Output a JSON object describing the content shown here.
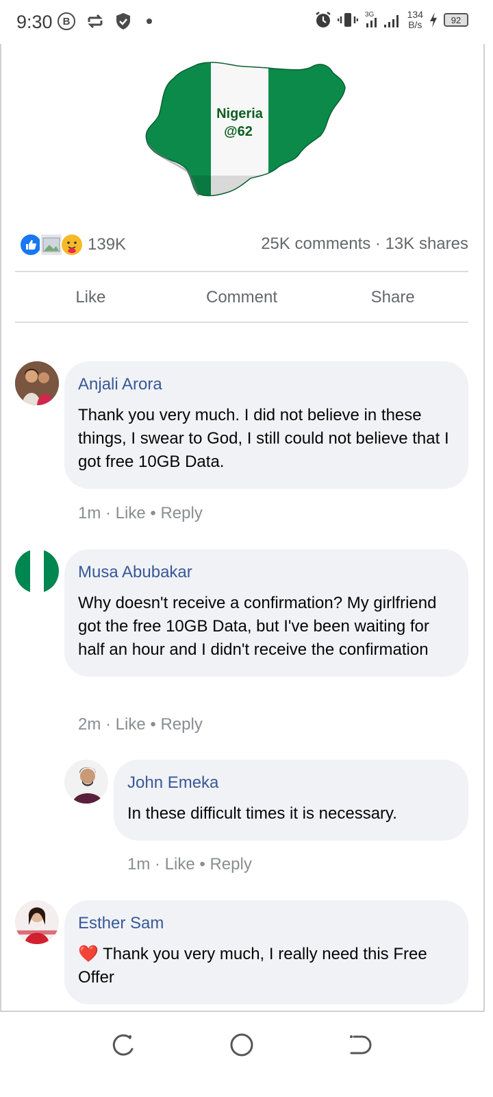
{
  "status_bar": {
    "time": "9:30",
    "b_badge": "B",
    "net_speed_value": "134",
    "net_speed_unit": "B/s",
    "network_type": "3G",
    "battery_level": "92"
  },
  "post": {
    "image_text_line1": "Nigeria",
    "image_text_line2": "@62",
    "reaction_count": "139K",
    "stats": "25K comments · 13K shares",
    "actions": {
      "like": "Like",
      "comment": "Comment",
      "share": "Share"
    }
  },
  "comments": [
    {
      "name": "Anjali Arora",
      "text": "Thank you very much. I did not believe in these things, I swear to God, I still could not believe that I got free 10GB Data.",
      "time": "1m",
      "like": "Like",
      "reply": "Reply"
    },
    {
      "name": "Musa Abubakar",
      "text": "Why doesn't receive a confirmation? My girlfriend got the free 10GB Data, but I've been waiting for half an hour and I didn't receive the confirmation",
      "time": "2m",
      "like": "Like",
      "reply": "Reply"
    },
    {
      "name": "John Emeka",
      "text": "In these difficult times it is necessary.",
      "time": "1m",
      "like": "Like",
      "reply": "Reply"
    },
    {
      "name": "Esther Sam",
      "emoji": "❤️",
      "text": " Thank you very much, I really need this Free Offer"
    }
  ],
  "colors": {
    "name_blue": "#385898",
    "bubble_bg": "#f0f2f5",
    "meta_gray": "#8a8d91",
    "nigeria_green": "#008751"
  },
  "icons": [
    "b-badge-icon",
    "repeat-icon",
    "shield-icon",
    "alarm-icon",
    "vibrate-icon",
    "signal-icon",
    "charging-icon",
    "battery-icon",
    "like-reaction-icon",
    "care-reaction-icon",
    "recent-apps-icon",
    "home-icon",
    "back-icon"
  ]
}
